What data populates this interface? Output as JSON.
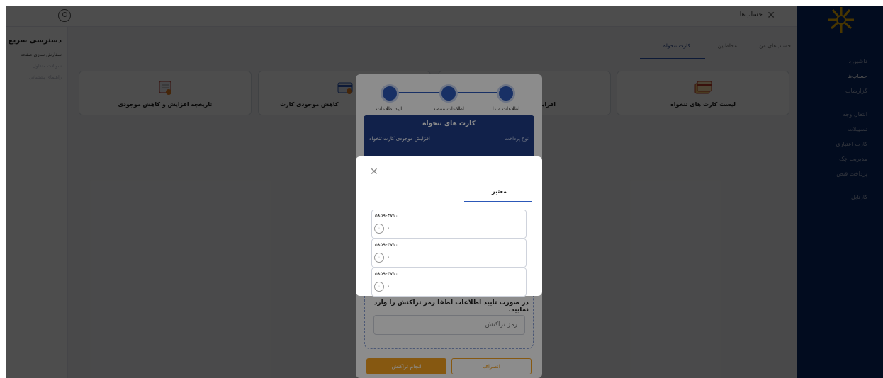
{
  "topbar": {
    "title": "حساب‌ها"
  },
  "sidebar": {
    "items": [
      {
        "label": "داشبورد",
        "active": false
      },
      {
        "label": "حساب‌ها",
        "active": true
      },
      {
        "label": "گزارشات",
        "active": false
      },
      {
        "label": "انتقال وجه",
        "active": false
      },
      {
        "label": "تسهیلات",
        "active": false
      },
      {
        "label": "کارت اعتباری",
        "active": false
      },
      {
        "label": "مدیریت چک",
        "active": false
      },
      {
        "label": "پرداخت قبض",
        "active": false
      },
      {
        "label": "کارتابل",
        "active": false
      }
    ]
  },
  "quick_access": {
    "title": "دسترسی سریع",
    "items": [
      "سفارش سازی صفحه",
      "سوالات متداول",
      "راهنمای پشتیبانی"
    ]
  },
  "tabs": [
    "حساب‌های من",
    "مخاطبین",
    "کارت تنخواه"
  ],
  "cards": [
    {
      "label": "لیست کارت های تنخواه"
    },
    {
      "label": "افزایش موجودی کارت"
    },
    {
      "label": "کاهش موجودی کارت"
    },
    {
      "label": "تاریخچه افزایش و کاهش موجودی"
    }
  ],
  "wizard": {
    "steps": [
      "اطلاعات مبدا",
      "اطلاعات مقصد",
      "تایید اطلاعات"
    ],
    "info_title": "کارت های تنخواه",
    "info_key": "نوع پرداخت",
    "info_value": "افزایش موجودی کارت تنخواه",
    "confirm_text": "در صورت تایید اطلاعات لطفا رمز تراکنش را وارد نمایید.",
    "password_placeholder": "رمز تراکنش",
    "do_button": "انجام تراکنش",
    "cancel_button": "انصراف"
  },
  "modal": {
    "tab": "معتبر",
    "items": [
      {
        "number": "۵۸۵۹-۴۷۱۰",
        "value": "۱"
      },
      {
        "number": "۵۸۵۹-۴۷۱۰",
        "value": "۱"
      },
      {
        "number": "۵۸۵۹-۴۷۱۰",
        "value": "۱"
      }
    ]
  },
  "colors": {
    "sidebar": "#0a2a6b",
    "primary": "#2c58b8",
    "accent": "#f4a020"
  }
}
